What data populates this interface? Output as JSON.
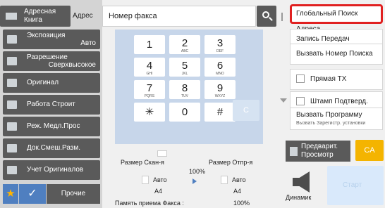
{
  "address": {
    "book_label": "Адресная Книга",
    "book_line1": "Адресная",
    "book_line2": "Книга",
    "label": "Адрес",
    "fax_placeholder": "Номер факса"
  },
  "settings": [
    {
      "label": "Экспозиция",
      "value": "Авто"
    },
    {
      "label": "Разрешение",
      "value": "Сверхвысокое"
    },
    {
      "label": "Оригинал",
      "value": ""
    },
    {
      "label": "Работа Строит",
      "value": ""
    },
    {
      "label": "Реж. Медл.Прос",
      "value": ""
    },
    {
      "label": "Док.Смеш.Разм.",
      "value": ""
    },
    {
      "label": "Учет Оригиналов",
      "value": ""
    }
  ],
  "bottom_left": {
    "other_label": "Прочие"
  },
  "keypad": {
    "keys": [
      {
        "n": "1",
        "s": ""
      },
      {
        "n": "2",
        "s": "ABC"
      },
      {
        "n": "3",
        "s": "DEF"
      },
      {
        "n": "4",
        "s": "GHI"
      },
      {
        "n": "5",
        "s": "JKL"
      },
      {
        "n": "6",
        "s": "MNO"
      },
      {
        "n": "7",
        "s": "PQRS"
      },
      {
        "n": "8",
        "s": "TUV"
      },
      {
        "n": "9",
        "s": "WXYZ"
      },
      {
        "n": "✳",
        "s": ""
      },
      {
        "n": "0",
        "s": ""
      },
      {
        "n": "#",
        "s": ""
      }
    ],
    "clear_label": "C"
  },
  "info": {
    "scan_size_label": "Размер Скан-я",
    "send_size_label": "Размер Отпр-я",
    "ratio": "100%",
    "scan_auto": "Авто",
    "send_auto": "Авто",
    "scan_paper": "A4",
    "send_paper": "A4",
    "memory_label": "Память приема Факса :",
    "memory_value": "100%"
  },
  "right_panel": {
    "global_search": "Глобальный Поиск Адреса",
    "send_log": "Запись Передач",
    "recall_number": "Вызвать Номер Поиска",
    "direct_tx": "Прямая ТХ",
    "stamp_confirm": "Штамп Подтверд.",
    "recall_program": "Вызвать Программу",
    "recall_program_sub": "Вызвать Зарегистр. установки",
    "preview_line1": "Предварит.",
    "preview_line2": "Просмотр",
    "ca": "CA",
    "speaker": "Динамик",
    "start": "Старт"
  }
}
